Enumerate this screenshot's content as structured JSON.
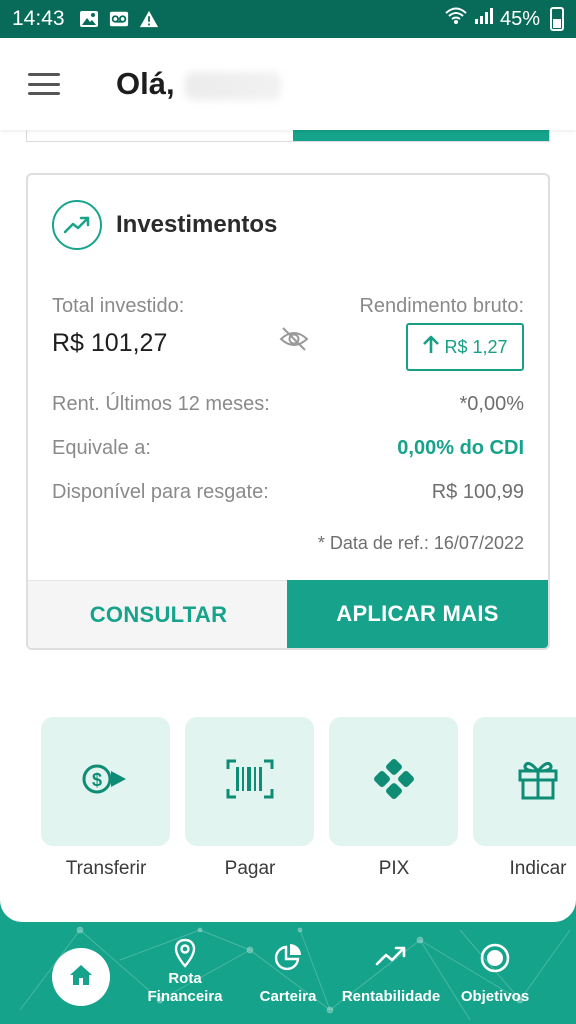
{
  "status_bar": {
    "time": "14:43",
    "battery": "45%"
  },
  "header": {
    "greeting": "Olá,"
  },
  "investments": {
    "title": "Investimentos",
    "total_label": "Total investido:",
    "total_value": "R$ 101,27",
    "yield_label": "Rendimento bruto:",
    "yield_value": "R$ 1,27",
    "rows": [
      {
        "label": "Rent. Últimos 12 meses:",
        "value": "*0,00%"
      },
      {
        "label": "Equivale a:",
        "value": "0,00% do CDI"
      },
      {
        "label": "Disponível para resgate:",
        "value": "R$ 100,99"
      }
    ],
    "ref_date": "* Data de ref.:  16/07/2022",
    "consult_label": "CONSULTAR",
    "apply_label": "APLICAR MAIS"
  },
  "shortcuts": [
    {
      "label": "Transferir",
      "icon": "transfer-icon"
    },
    {
      "label": "Pagar",
      "icon": "barcode-icon"
    },
    {
      "label": "PIX",
      "icon": "pix-icon"
    },
    {
      "label": "Indicar",
      "icon": "gift-icon"
    }
  ],
  "bottom_nav": [
    {
      "label": "Home",
      "icon": "home-icon"
    },
    {
      "label": "Rota Financeira",
      "line1": "Rota",
      "line2": "Financeira",
      "icon": "location-pin-icon"
    },
    {
      "label": "Carteira",
      "icon": "pie-chart-icon"
    },
    {
      "label": "Rentabilidade",
      "icon": "trend-up-icon"
    },
    {
      "label": "Objetivos",
      "icon": "target-icon"
    }
  ],
  "colors": {
    "primary": "#17a38b",
    "status_bar": "#086b59",
    "shortcut_bg": "#e2f4ef"
  }
}
